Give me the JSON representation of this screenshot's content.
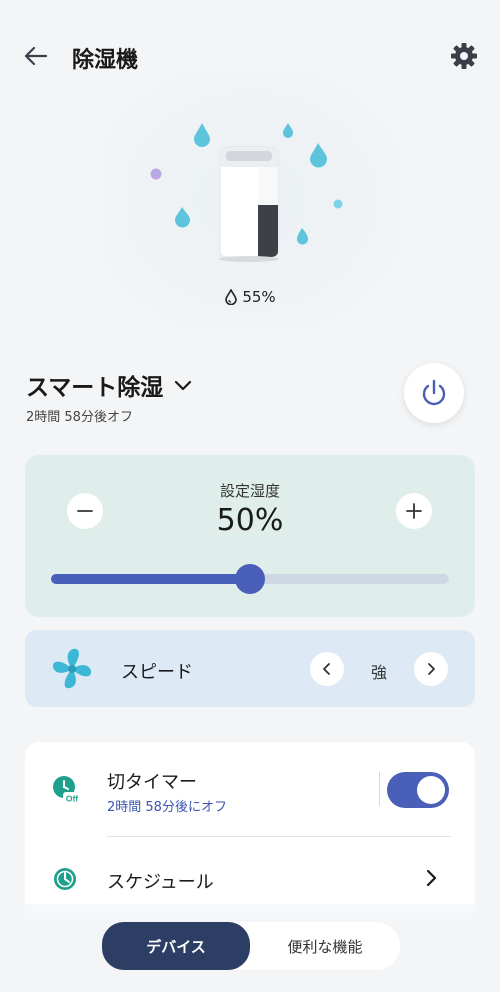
{
  "header": {
    "title": "除湿機",
    "back_icon": "arrow-left-icon",
    "settings_icon": "gear-icon"
  },
  "device": {
    "humidity_text": "55%",
    "humidity_icon": "water-drop-icon"
  },
  "mode": {
    "name": "スマート除湿",
    "subtitle": "2時間 58分後オフ"
  },
  "humidity_setting": {
    "label": "設定湿度",
    "value_text": "50%",
    "value": 50
  },
  "speed": {
    "label": "スピード",
    "value": "強"
  },
  "timer": {
    "title": "切タイマー",
    "subtitle": "2時間 58分後にオフ",
    "enabled": true
  },
  "schedule": {
    "title": "スケジュール"
  },
  "bottom_tabs": {
    "device_label": "デバイス",
    "features_label": "便利な機能"
  },
  "colors": {
    "accent": "#4a5fb8",
    "teal": "#1fa08c",
    "drop": "#5ec4dc",
    "tab_active": "#2c3e63"
  }
}
